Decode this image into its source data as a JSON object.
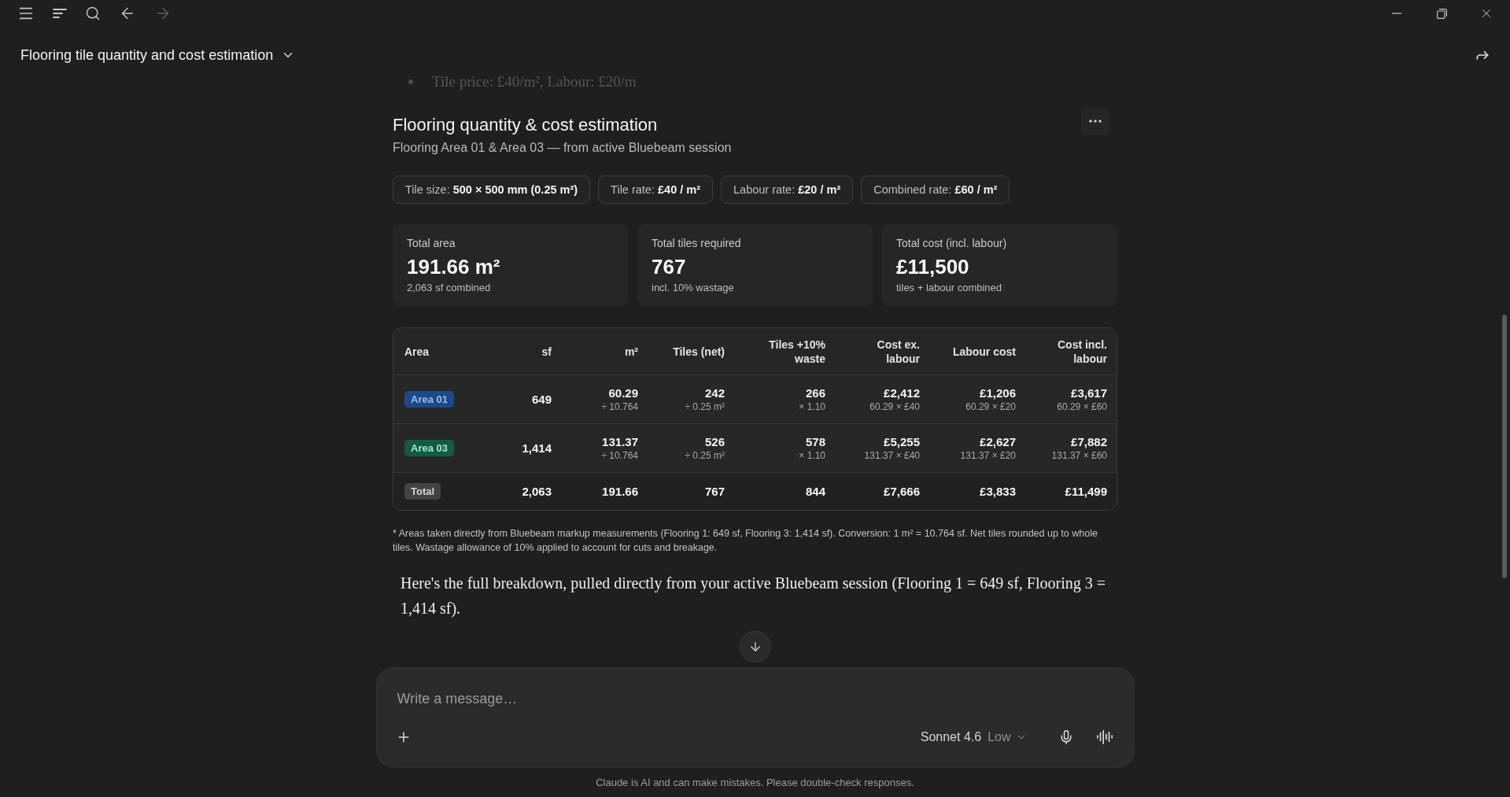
{
  "navigation": {
    "forward_disabled": true
  },
  "conversation_title": "Flooring tile quantity and cost estimation",
  "previous_message": {
    "bullet_text": "Tile price: £40/m², Labour: £20/m"
  },
  "artifact": {
    "title": "Flooring quantity & cost estimation",
    "subtitle": "Flooring Area 01 & Area 03 — from active Bluebeam session",
    "rate_chips": [
      "Tile size: **500 × 500 mm (0.25 m²)**",
      "Tile rate: **£40 / m²**",
      "Labour rate: **£20 / m²**",
      "Combined rate: **£60 / m²**"
    ],
    "stats": [
      {
        "label": "Total area",
        "value": "191.66 m²",
        "note": "2,063 sf combined"
      },
      {
        "label": "Total tiles required",
        "value": "767",
        "note": "incl. 10% wastage"
      },
      {
        "label": "Total cost (incl. labour)",
        "value": "£11,500",
        "note": "tiles + labour combined"
      }
    ],
    "table": {
      "columns": [
        "Area",
        "sf",
        "m²",
        "Tiles (net)",
        "Tiles +10% waste",
        "Cost ex. labour",
        "Labour cost",
        "Cost incl. labour"
      ],
      "rows": [
        {
          "color": "#1b4a86",
          "cells": [
            {
              "value": "Area 01"
            },
            {
              "value": "649"
            },
            {
              "value": "60.29",
              "note": "÷ 10.764"
            },
            {
              "value": "242",
              "note": "÷ 0.25 m²"
            },
            {
              "value": "266",
              "note": "× 1.10"
            },
            {
              "value": "£2,412",
              "note": "60.29 × £40"
            },
            {
              "value": "£1,206",
              "note": "60.29 × £20"
            },
            {
              "value": "£3,617",
              "note": "60.29 × £60"
            }
          ]
        },
        {
          "color": "#155a42",
          "cells": [
            {
              "value": "Area 03"
            },
            {
              "value": "1,414"
            },
            {
              "value": "131.37",
              "note": "÷ 10.764"
            },
            {
              "value": "526",
              "note": "÷ 0.25 m²"
            },
            {
              "value": "578",
              "note": "× 1.10"
            },
            {
              "value": "£5,255",
              "note": "131.37 × £40"
            },
            {
              "value": "£2,627",
              "note": "131.37 × £20"
            },
            {
              "value": "£7,882",
              "note": "131.37 × £60"
            }
          ]
        }
      ],
      "total": {
        "cells": [
          "Total",
          "2,063",
          "191.66",
          "767",
          "844",
          "£7,666",
          "£3,833",
          "£11,499"
        ]
      }
    },
    "footnote": "* Areas taken directly from Bluebeam markup measurements (Flooring 1: 649 sf, Flooring 3: 1,414 sf). Conversion: 1 m² = 10.764 sf. Net tiles rounded up to whole tiles. Wastage allowance of 10% applied to account for cuts and breakage."
  },
  "reply_text": "Here's the full breakdown, pulled directly from your active Bluebeam session (Flooring 1 = 649 sf, Flooring 3 = 1,414 sf).",
  "composer": {
    "placeholder": "Write a message…",
    "model": "Sonnet 4.6",
    "effort": "Low"
  },
  "disclaimer": "Claude is AI and can make mistakes. Please double-check responses."
}
